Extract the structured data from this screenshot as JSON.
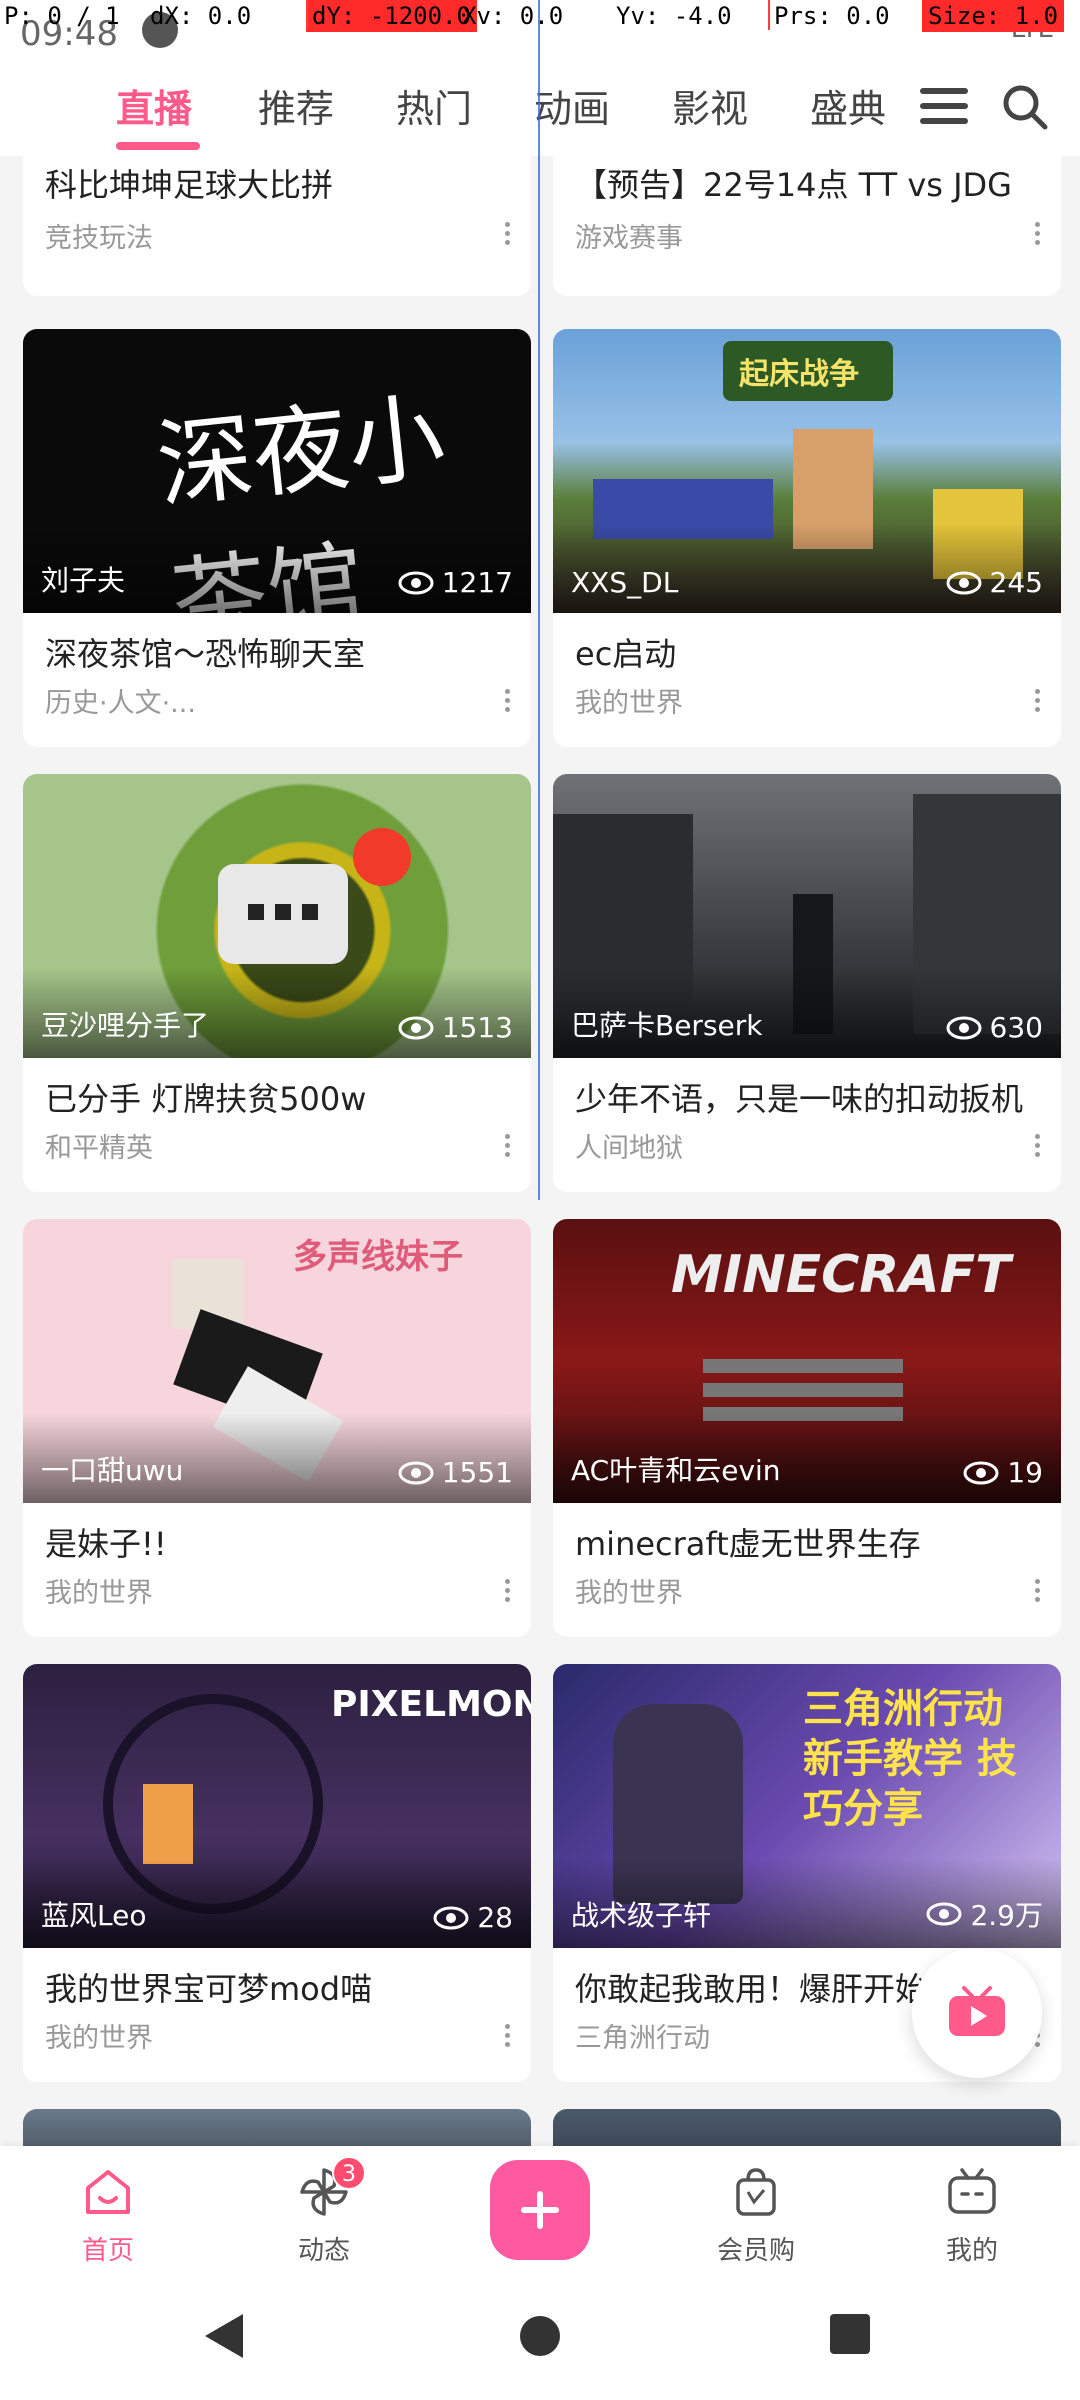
{
  "debug": {
    "p": "P: 0 / 1",
    "dx": "dX: 0.0",
    "dy": "dY: -1200.0",
    "xv": "Xv: 0.0",
    "yv": "Yv: -4.0",
    "prs": "Prs: 0.0",
    "size": "Size: 1.0"
  },
  "status": {
    "time": "09:48",
    "right": "LTE"
  },
  "tabs": [
    {
      "label": "直播",
      "active": true
    },
    {
      "label": "推荐"
    },
    {
      "label": "热门"
    },
    {
      "label": "动画"
    },
    {
      "label": "影视"
    },
    {
      "label": "盛典"
    }
  ],
  "cards": [
    {
      "title": "科比坤坤足球大比拼",
      "sub": "竞技玩法"
    },
    {
      "title": "【预告】22号14点 TT vs JDG",
      "sub": "游戏赛事"
    },
    {
      "author": "刘子夫",
      "views": "1217",
      "title": "深夜茶馆～恐怖聊天室",
      "sub": "历史·人文·...",
      "overlay": "深夜小茶馆"
    },
    {
      "author": "XXS_DL",
      "views": "245",
      "title": "ec启动",
      "sub": "我的世界",
      "overlay": "起床战争"
    },
    {
      "author": "豆沙哩分手了",
      "views": "1513",
      "title": "已分手 灯牌扶贫500w",
      "sub": "和平精英"
    },
    {
      "author": "巴萨卡Berserk",
      "views": "630",
      "title": "少年不语，只是一味的扣动扳机",
      "sub": "人间地狱"
    },
    {
      "author": "一口甜uwu",
      "views": "1551",
      "title": "是妹子!!",
      "sub": "我的世界",
      "overlay": "多声线妹子"
    },
    {
      "author": "AC叶青和云evin",
      "views": "19",
      "title": "minecraft虚无世界生存",
      "sub": "我的世界",
      "overlay": "MINECRAFT"
    },
    {
      "author": "蓝风Leo",
      "views": "28",
      "title": "我的世界宝可梦mod喵",
      "sub": "我的世界",
      "overlay": "PIXELMON"
    },
    {
      "author": "战术级子轩",
      "views": "2.9万",
      "title": "你敢起我敢用！爆肝开始",
      "sub": "三角洲行动",
      "overlay": "三角洲行动 新手教学 技巧分享"
    }
  ],
  "bottom_nav": {
    "home": "首页",
    "dynamic": "动态",
    "dynamic_badge": "3",
    "vip_shop": "会员购",
    "mine": "我的"
  }
}
